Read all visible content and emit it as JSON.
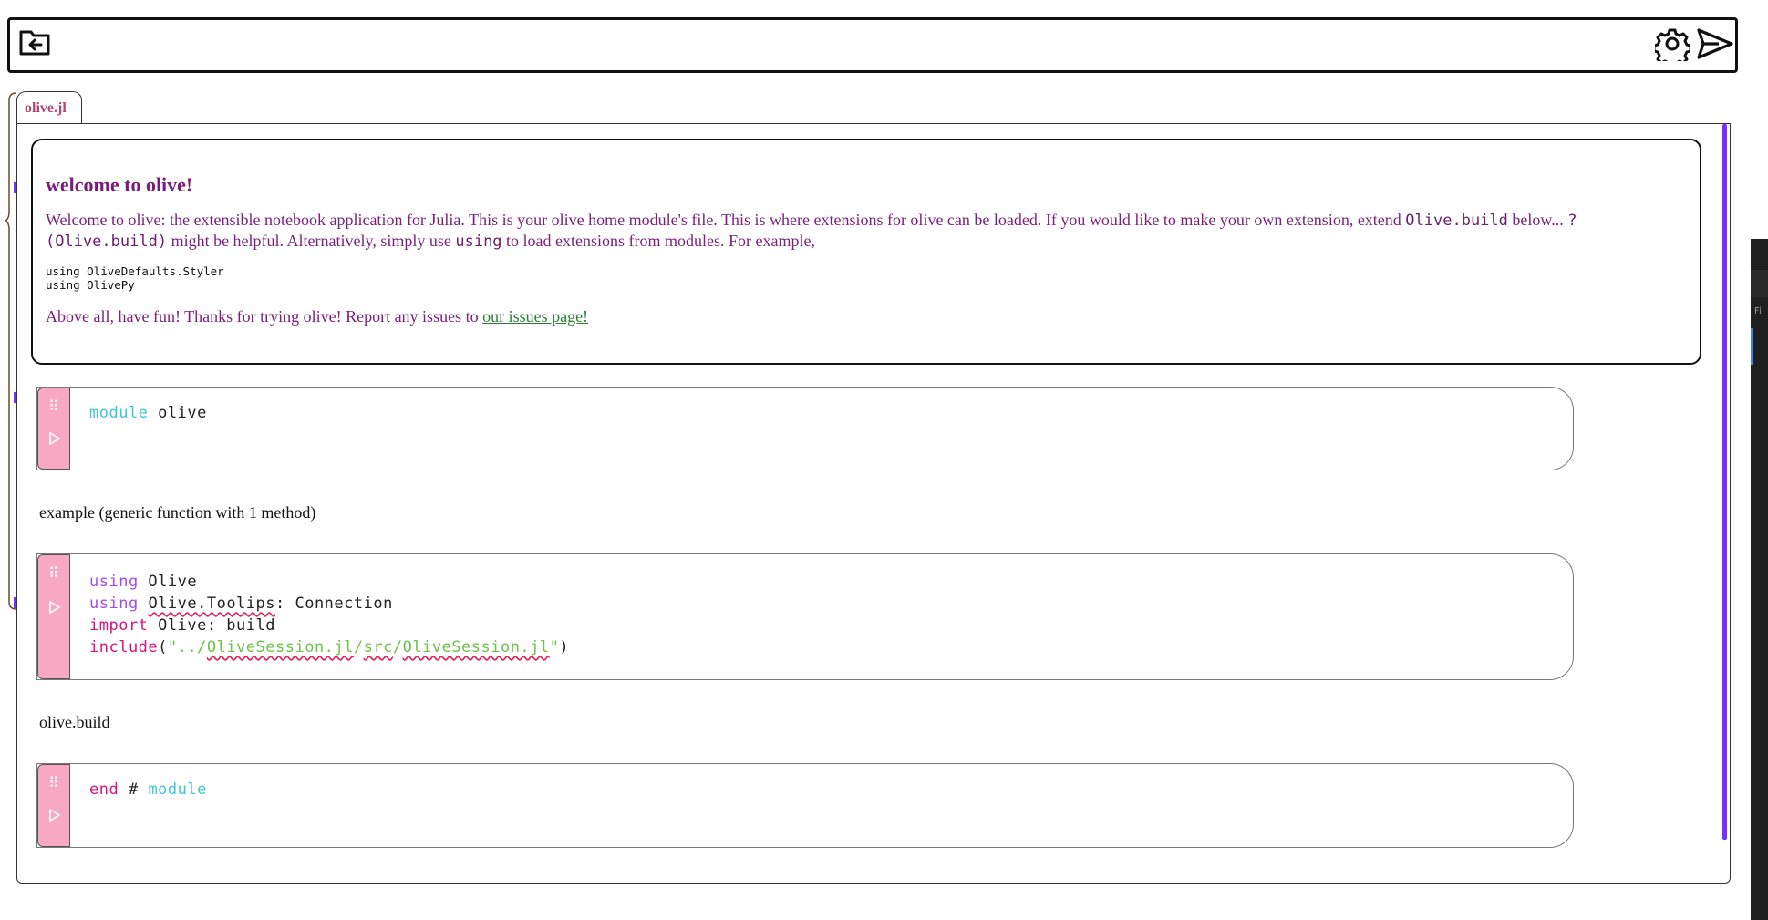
{
  "topbar": {
    "icons": {
      "left": "folder-back-icon",
      "settings": "gear-icon",
      "send": "send-icon"
    }
  },
  "tab": {
    "label": "olive.jl"
  },
  "markdown": {
    "heading": "welcome to olive!",
    "p1_a": "Welcome to olive: the extensible notebook application for Julia. This is your olive home module's file. This is where extensions for olive can be loaded. If you would like to make your own extension, extend ",
    "p1_code1": "Olive.build",
    "p1_b": " below... ",
    "p1_code2": "?(Olive.build)",
    "p1_c": " might be helpful. Alternatively, simply use ",
    "p1_code3": "using",
    "p1_d": " to load extensions from modules. For example,",
    "code_block": "using OliveDefaults.Styler\nusing OlivePy",
    "p2_a": "Above all, have fun! Thanks for trying olive! Report any issues to ",
    "p2_link": "our issues page!"
  },
  "cell1": {
    "kw": "module",
    "rest": " olive"
  },
  "output1": {
    "text": "example (generic function with 1 method)"
  },
  "cell2": {
    "l1_kw": "using",
    "l1_rest": " Olive",
    "l2_kw": "using",
    "l2_mod": "Olive.Toolips",
    "l2_rest": ": Connection",
    "l3_kw": "import",
    "l3_rest": " Olive: build",
    "l4_fn": "include",
    "l4_open": "(",
    "l4_s1": "\"../",
    "l4_s2": "OliveSession.jl",
    "l4_s3": "/",
    "l4_s4": "src",
    "l4_s5": "/",
    "l4_s6": "OliveSession.jl",
    "l4_s7": "\"",
    "l4_close": ")"
  },
  "output2": {
    "text": "olive.build"
  },
  "cell3": {
    "kw": "end",
    "mid": " # ",
    "cm": "module"
  },
  "colors": {
    "cell_side": "#f9a8c4",
    "scroll_accent": "#7b2ff7",
    "markdown_text": "#7a1f7a",
    "link": "#2e7d32"
  },
  "right_panel": {
    "label": "Fi"
  }
}
